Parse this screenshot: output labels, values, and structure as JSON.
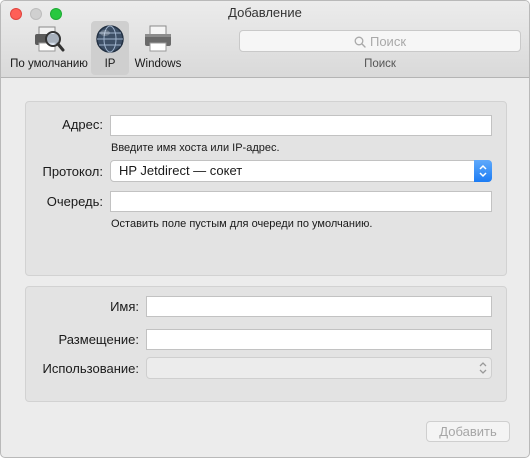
{
  "window": {
    "title": "Добавление"
  },
  "toolbar": {
    "tools": [
      {
        "label": "По умолчанию",
        "icon": "printer-search-icon",
        "selected": false
      },
      {
        "label": "IP",
        "icon": "globe-icon",
        "selected": true
      },
      {
        "label": "Windows",
        "icon": "printer-icon",
        "selected": false
      }
    ],
    "search": {
      "placeholder": "Поиск",
      "caption": "Поиск",
      "icon": "search-icon"
    }
  },
  "connection": {
    "address_label": "Адрес:",
    "address_value": "",
    "address_hint": "Введите имя хоста или IP-адрес.",
    "protocol_label": "Протокол:",
    "protocol_value": "HP Jetdirect — сокет",
    "queue_label": "Очередь:",
    "queue_value": "",
    "queue_hint": "Оставить поле пустым для очереди по умолчанию."
  },
  "details": {
    "name_label": "Имя:",
    "name_value": "",
    "location_label": "Размещение:",
    "location_value": "",
    "use_label": "Использование:",
    "use_value": ""
  },
  "footer": {
    "add_label": "Добавить"
  },
  "colors": {
    "accent": "#1c7cf4",
    "close": "#ff5f57",
    "zoom": "#28c840"
  }
}
